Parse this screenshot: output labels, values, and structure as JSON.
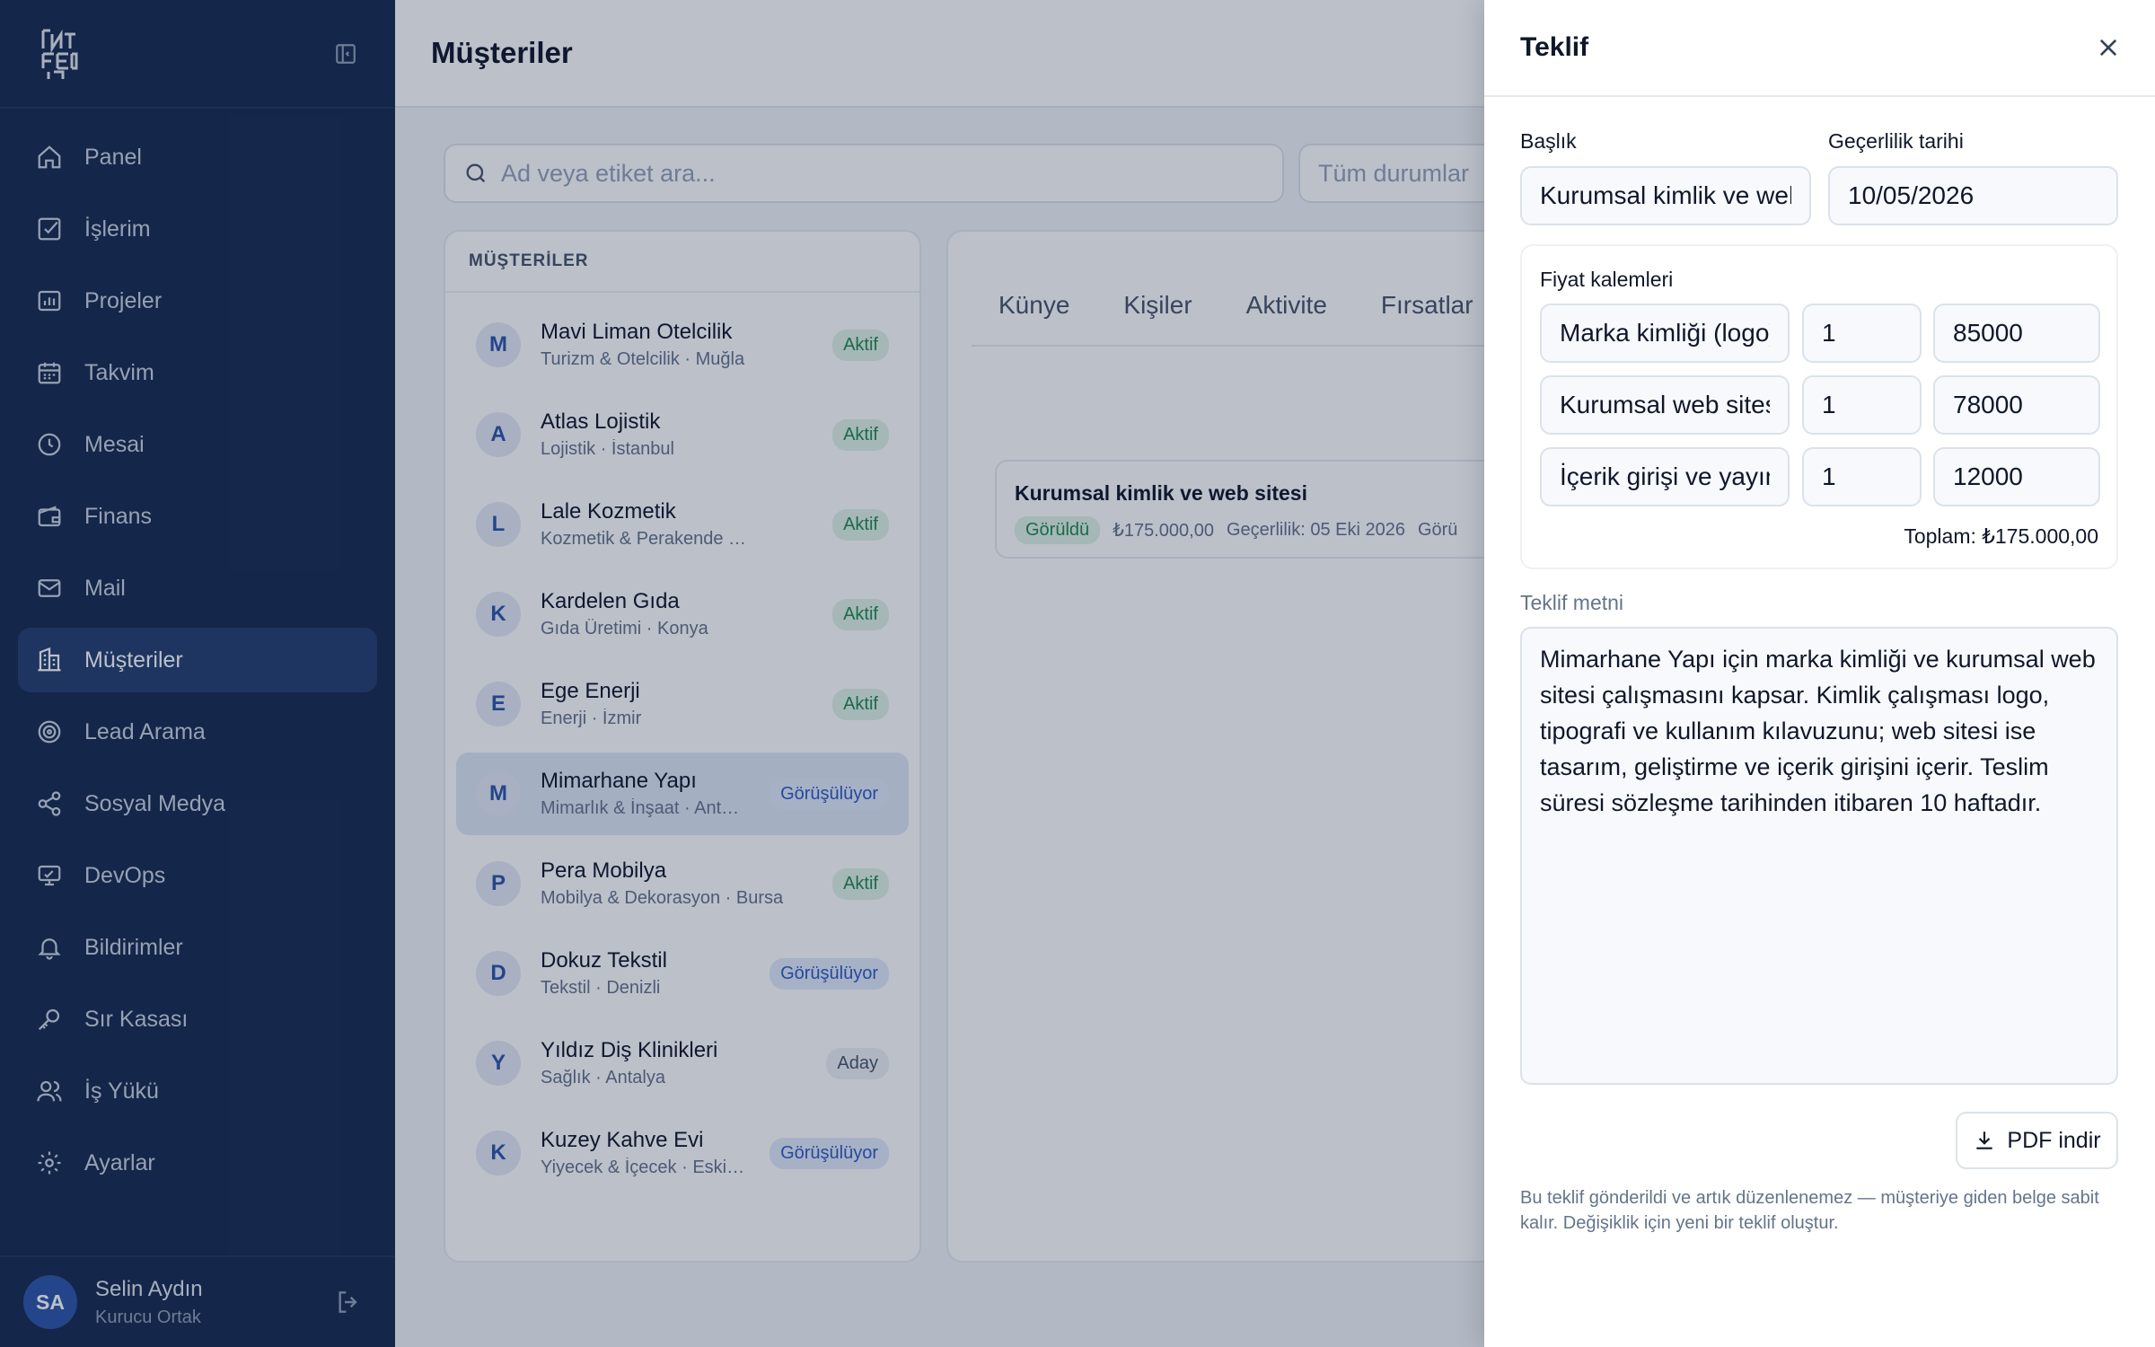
{
  "colors": {
    "sidebar_bg": "#172a4f",
    "accent": "#2d55a8",
    "active_nav": "#233f6e",
    "badge_green": "#1f8a4c",
    "badge_blue": "#2f5bc3"
  },
  "sidebar": {
    "items": [
      {
        "label": "Panel",
        "icon": "home-icon"
      },
      {
        "label": "İşlerim",
        "icon": "check-square-icon"
      },
      {
        "label": "Projeler",
        "icon": "chart-icon"
      },
      {
        "label": "Takvim",
        "icon": "calendar-icon"
      },
      {
        "label": "Mesai",
        "icon": "clock-icon"
      },
      {
        "label": "Finans",
        "icon": "wallet-icon"
      },
      {
        "label": "Mail",
        "icon": "mail-icon"
      },
      {
        "label": "Müşteriler",
        "icon": "building-icon"
      },
      {
        "label": "Lead Arama",
        "icon": "target-icon"
      },
      {
        "label": "Sosyal Medya",
        "icon": "share-icon"
      },
      {
        "label": "DevOps",
        "icon": "monitor-icon"
      },
      {
        "label": "Bildirimler",
        "icon": "bell-icon"
      },
      {
        "label": "Sır Kasası",
        "icon": "key-icon"
      },
      {
        "label": "İş Yükü",
        "icon": "users-icon"
      },
      {
        "label": "Ayarlar",
        "icon": "gear-icon"
      }
    ],
    "user": {
      "initials": "SA",
      "name": "Selin Aydın",
      "role": "Kurucu Ortak"
    }
  },
  "main": {
    "title": "Müşteriler",
    "search": {
      "placeholder": "Ad veya etiket ara..."
    },
    "status_filter": "Tüm durumlar",
    "list_title": "MÜŞTERİLER",
    "customers": [
      {
        "initial": "M",
        "name": "Mavi Liman Otelcilik",
        "sub": "Turizm & Otelcilik · Muğla",
        "status": "Aktif"
      },
      {
        "initial": "A",
        "name": "Atlas Lojistik",
        "sub": "Lojistik · İstanbul",
        "status": "Aktif"
      },
      {
        "initial": "L",
        "name": "Lale Kozmetik",
        "sub": "Kozmetik & Perakende · İzmir",
        "status": "Aktif"
      },
      {
        "initial": "K",
        "name": "Kardelen Gıda",
        "sub": "Gıda Üretimi · Konya",
        "status": "Aktif"
      },
      {
        "initial": "E",
        "name": "Ege Enerji",
        "sub": "Enerji · İzmir",
        "status": "Aktif"
      },
      {
        "initial": "M",
        "name": "Mimarhane Yapı",
        "sub": "Mimarlık & İnşaat · Antalya",
        "status": "Görüşülüyor"
      },
      {
        "initial": "P",
        "name": "Pera Mobilya",
        "sub": "Mobilya & Dekorasyon · Bursa",
        "status": "Aktif"
      },
      {
        "initial": "D",
        "name": "Dokuz Tekstil",
        "sub": "Tekstil · Denizli",
        "status": "Görüşülüyor"
      },
      {
        "initial": "Y",
        "name": "Yıldız Diş Klinikleri",
        "sub": "Sağlık · Antalya",
        "status": "Aday"
      },
      {
        "initial": "K",
        "name": "Kuzey Kahve Evi",
        "sub": "Yiyecek & İçecek · Eskişehir",
        "status": "Görüşülüyor"
      }
    ],
    "tabs": [
      "Künye",
      "Kişiler",
      "Aktivite",
      "Fırsatlar"
    ],
    "offer": {
      "title": "Kurumsal kimlik ve web sitesi",
      "status": "Görüldü",
      "amount": "₺175.000,00",
      "validity": "Geçerlilik: 05 Eki 2026",
      "extra": "Görü"
    }
  },
  "drawer": {
    "title": "Teklif",
    "title_label": "Başlık",
    "title_value": "Kurumsal kimlik ve web sitesi",
    "date_label": "Geçerlilik tarihi",
    "date_value": "10/05/2026",
    "items_label": "Fiyat kalemleri",
    "items": [
      {
        "desc": "Marka kimliği (logo)",
        "qty": "1",
        "price": "85000"
      },
      {
        "desc": "Kurumsal web sitesi",
        "qty": "1",
        "price": "78000"
      },
      {
        "desc": "İçerik girişi ve yayın",
        "qty": "1",
        "price": "12000"
      }
    ],
    "total": "Toplam: ₺175.000,00",
    "text_label": "Teklif metni",
    "text": "Mimarhane Yapı için marka kimliği ve kurumsal web sitesi çalışmasını kapsar. Kimlik çalışması logo, tipografi ve kullanım kılavuzunu; web sitesi ise tasarım, geliştirme ve içerik girişini içerir. Teslim süresi sözleşme tarihinden itibaren 10 haftadır.",
    "pdf_label": "PDF indir",
    "note": "Bu teklif gönderildi ve artık düzenlenemez — müşteriye giden belge sabit kalır. Değişiklik için yeni bir teklif oluştur."
  }
}
